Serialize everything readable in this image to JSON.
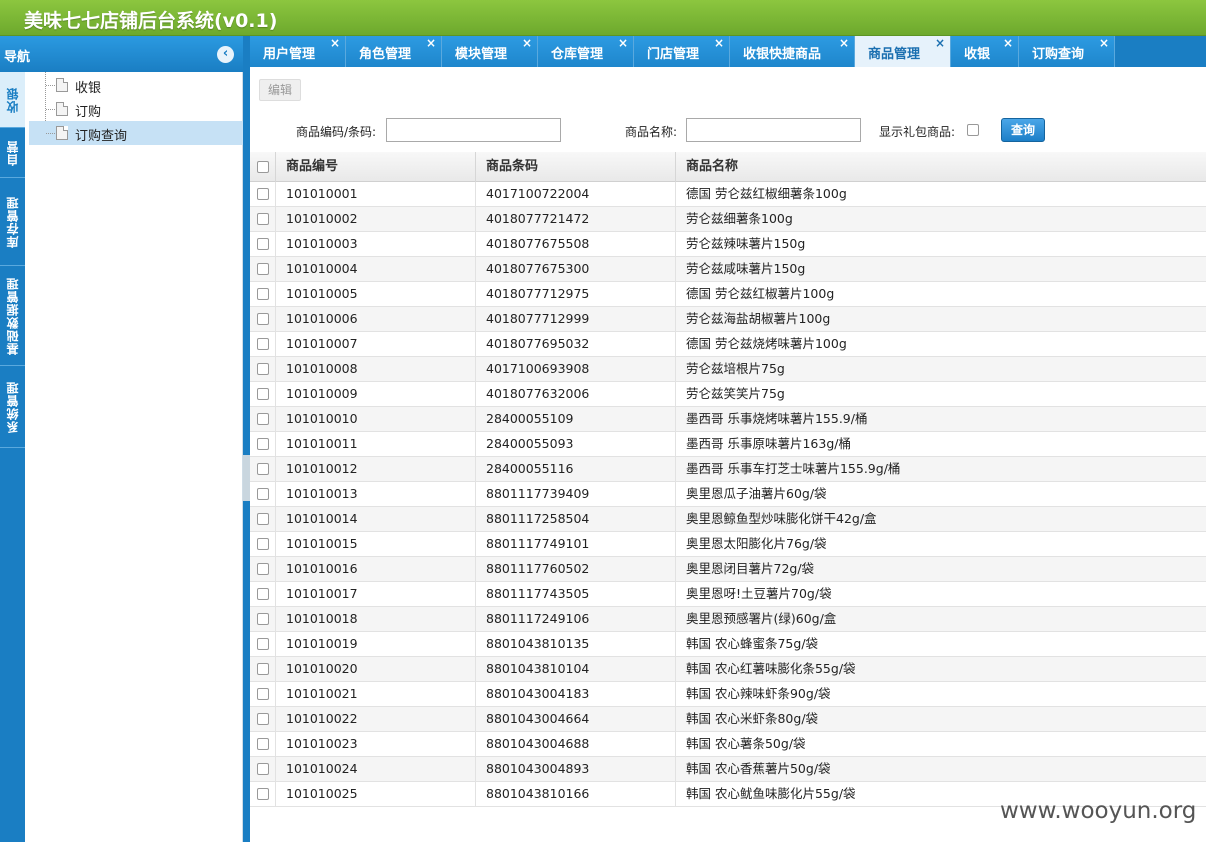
{
  "app": {
    "title": "美味七七店铺后台系统(v0.1)"
  },
  "nav": {
    "title": "导航",
    "collapse_icon": "chevron-left-circle-icon",
    "vertical_tabs": [
      "收银",
      "自营",
      "库存管理",
      "基础数据管理",
      "系统管理"
    ],
    "active_vertical_tab": "收银",
    "tree_items": [
      {
        "label": "收银",
        "icon": "file-icon"
      },
      {
        "label": "订购",
        "icon": "file-icon"
      },
      {
        "label": "订购查询",
        "icon": "file-icon",
        "selected": true
      }
    ]
  },
  "tabs": [
    {
      "label": "用户管理",
      "close": "×"
    },
    {
      "label": "角色管理",
      "close": "×"
    },
    {
      "label": "模块管理",
      "close": "×"
    },
    {
      "label": "仓库管理",
      "close": "×"
    },
    {
      "label": "门店管理",
      "close": "×"
    },
    {
      "label": "收银快捷商品",
      "close": "×"
    },
    {
      "label": "商品管理",
      "close": "×",
      "active": true
    },
    {
      "label": "收银",
      "close": "×"
    },
    {
      "label": "订购查询",
      "close": "×"
    }
  ],
  "toolbar": {
    "edit_label": "编辑"
  },
  "search": {
    "code_label": "商品编码/条码:",
    "code_value": "",
    "name_label": "商品名称:",
    "name_value": "",
    "gift_label": "显示礼包商品:",
    "gift_checked": false,
    "query_label": "查询"
  },
  "grid": {
    "columns": [
      "商品编号",
      "商品条码",
      "商品名称"
    ],
    "rows": [
      {
        "code": "101010001",
        "barcode": "4017100722004",
        "name": "德国 劳仑兹红椒细薯条100g"
      },
      {
        "code": "101010002",
        "barcode": "4018077721472",
        "name": "劳仑兹细薯条100g"
      },
      {
        "code": "101010003",
        "barcode": "4018077675508",
        "name": "劳仑兹辣味薯片150g"
      },
      {
        "code": "101010004",
        "barcode": "4018077675300",
        "name": "劳仑兹咸味薯片150g"
      },
      {
        "code": "101010005",
        "barcode": "4018077712975",
        "name": "德国 劳仑兹红椒薯片100g"
      },
      {
        "code": "101010006",
        "barcode": "4018077712999",
        "name": "劳仑兹海盐胡椒薯片100g"
      },
      {
        "code": "101010007",
        "barcode": "4018077695032",
        "name": "德国 劳仑兹烧烤味薯片100g"
      },
      {
        "code": "101010008",
        "barcode": "4017100693908",
        "name": "劳仑兹培根片75g"
      },
      {
        "code": "101010009",
        "barcode": "4018077632006",
        "name": "劳仑兹笑笑片75g"
      },
      {
        "code": "101010010",
        "barcode": "28400055109",
        "name": "墨西哥 乐事烧烤味薯片155.9/桶"
      },
      {
        "code": "101010011",
        "barcode": "28400055093",
        "name": "墨西哥 乐事原味薯片163g/桶"
      },
      {
        "code": "101010012",
        "barcode": "28400055116",
        "name": "墨西哥 乐事车打芝士味薯片155.9g/桶"
      },
      {
        "code": "101010013",
        "barcode": "8801117739409",
        "name": "奥里恩瓜子油薯片60g/袋"
      },
      {
        "code": "101010014",
        "barcode": "8801117258504",
        "name": "奥里恩鲸鱼型炒味膨化饼干42g/盒"
      },
      {
        "code": "101010015",
        "barcode": "8801117749101",
        "name": "奥里恩太阳膨化片76g/袋"
      },
      {
        "code": "101010016",
        "barcode": "8801117760502",
        "name": "奥里恩闭目薯片72g/袋"
      },
      {
        "code": "101010017",
        "barcode": "8801117743505",
        "name": "奥里恩呀!土豆薯片70g/袋"
      },
      {
        "code": "101010018",
        "barcode": "8801117249106",
        "name": "奥里恩预感署片(绿)60g/盒"
      },
      {
        "code": "101010019",
        "barcode": "8801043810135",
        "name": "韩国 农心蜂蜜条75g/袋"
      },
      {
        "code": "101010020",
        "barcode": "8801043810104",
        "name": "韩国 农心红薯味膨化条55g/袋"
      },
      {
        "code": "101010021",
        "barcode": "8801043004183",
        "name": "韩国 农心辣味虾条90g/袋"
      },
      {
        "code": "101010022",
        "barcode": "8801043004664",
        "name": "韩国 农心米虾条80g/袋"
      },
      {
        "code": "101010023",
        "barcode": "8801043004688",
        "name": "韩国 农心薯条50g/袋"
      },
      {
        "code": "101010024",
        "barcode": "8801043004893",
        "name": "韩国 农心香蕉薯片50g/袋"
      },
      {
        "code": "101010025",
        "barcode": "8801043810166",
        "name": "韩国 农心鱿鱼味膨化片55g/袋"
      }
    ]
  },
  "watermark": "www.wooyun.org",
  "colors": {
    "header_green": "#7ab833",
    "nav_blue": "#1a7ec3",
    "query_blue": "#1c7fc8"
  }
}
